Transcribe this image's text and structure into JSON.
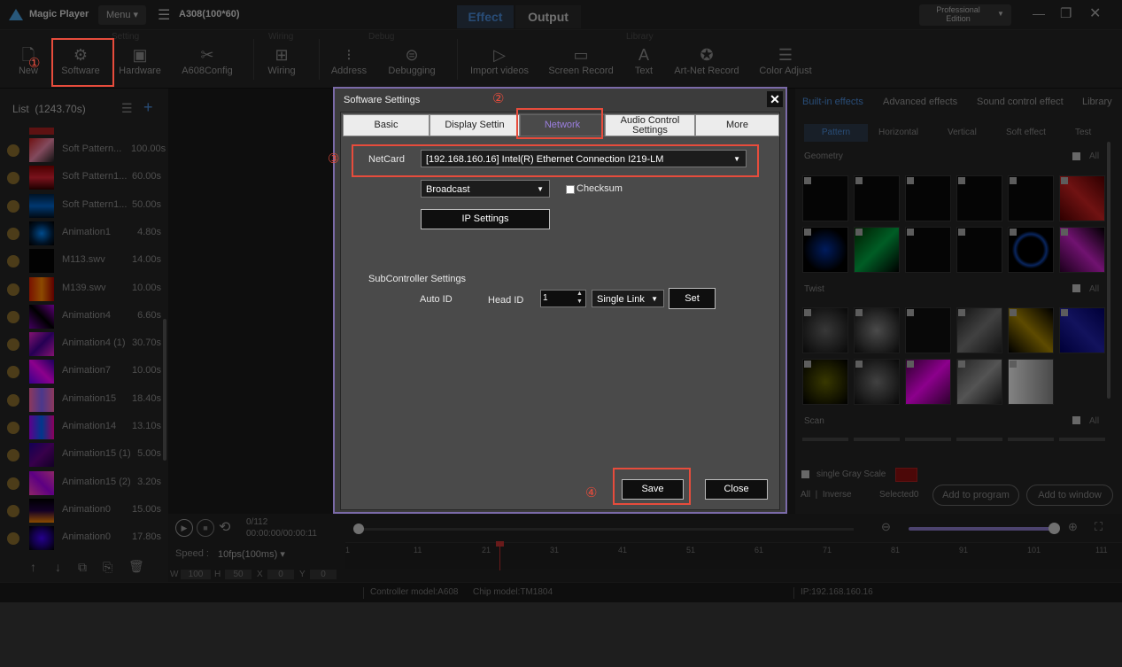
{
  "app": {
    "name": "Magic Player",
    "menu": "Menu",
    "project": "A308(100*60)",
    "mode_tabs": [
      "Effect",
      "Output"
    ],
    "edition": "Professional\nEdition"
  },
  "ribbon": {
    "groups": [
      "Setting",
      "Wiring",
      "Debug",
      "Library"
    ],
    "buttons": [
      "New",
      "Software",
      "Hardware",
      "A608Config",
      "Wiring",
      "Address",
      "Debugging",
      "Import videos",
      "Screen Record",
      "Text",
      "Art-Net Record",
      "Color Adjust"
    ]
  },
  "list": {
    "header": "List  (1243.70s)",
    "items": [
      {
        "name": "Soft Pattern...",
        "dur": "100.00s"
      },
      {
        "name": "Soft Pattern1...",
        "dur": "60.00s"
      },
      {
        "name": "Soft Pattern1...",
        "dur": "50.00s"
      },
      {
        "name": "Animation1",
        "dur": "4.80s"
      },
      {
        "name": "M113.swv",
        "dur": "14.00s"
      },
      {
        "name": "M139.swv",
        "dur": "10.00s"
      },
      {
        "name": "Animation4",
        "dur": "6.60s"
      },
      {
        "name": "Animation4 (1)",
        "dur": "30.70s"
      },
      {
        "name": "Animation7",
        "dur": "10.00s"
      },
      {
        "name": "Animation15",
        "dur": "18.40s"
      },
      {
        "name": "Animation14",
        "dur": "13.10s"
      },
      {
        "name": "Animation15 (1)",
        "dur": "5.00s"
      },
      {
        "name": "Animation15 (2)",
        "dur": "3.20s"
      },
      {
        "name": "Animation0",
        "dur": "15.00s"
      },
      {
        "name": "Animation0",
        "dur": "17.80s"
      }
    ]
  },
  "right": {
    "tabs": [
      "Built-in effects",
      "Advanced effects",
      "Sound control effect",
      "Library"
    ],
    "subtabs": [
      "Pattern",
      "Horizontal",
      "Vertical",
      "Soft effect",
      "Test"
    ],
    "sections": [
      "Geometry",
      "Twist",
      "Scan"
    ],
    "all": "All",
    "gray": "single Gray Scale",
    "all_inverse": "All  |  Inverse",
    "selected": "Selected0",
    "add_program": "Add to program",
    "add_window": "Add to window"
  },
  "player": {
    "frames": "0/112",
    "time": "00:00:00/00:00:11",
    "speed_label": "Speed :",
    "speed": "10fps(100ms)",
    "w_label": "W",
    "w": "100",
    "h_label": "H",
    "h": "50",
    "x_label": "X",
    "x": "0",
    "y_label": "Y",
    "y": "0",
    "ticks": [
      "1",
      "11",
      "21",
      "31",
      "41",
      "51",
      "61",
      "71",
      "81",
      "91",
      "101",
      "111"
    ]
  },
  "status": {
    "controller": "Controller model:A608",
    "chip": "Chip model:TM1804",
    "ip": "IP:192.168.160.16"
  },
  "dialog": {
    "title": "Software Settings",
    "tabs": [
      "Basic",
      "Display Settin",
      "Network",
      "Audio Control\nSettings",
      "More"
    ],
    "netcard_label": "NetCard",
    "netcard_value": "[192.168.160.16] Intel(R) Ethernet Connection I219-LM",
    "broadcast": "Broadcast",
    "checksum": "Checksum",
    "ip_settings": "IP Settings",
    "sub_title": "SubController Settings",
    "auto_id": "Auto ID",
    "head_id": "Head ID",
    "head_id_value": "1",
    "link": "Single Link",
    "set": "Set",
    "save": "Save",
    "close": "Close"
  },
  "steps": [
    "①",
    "②",
    "③",
    "④"
  ]
}
